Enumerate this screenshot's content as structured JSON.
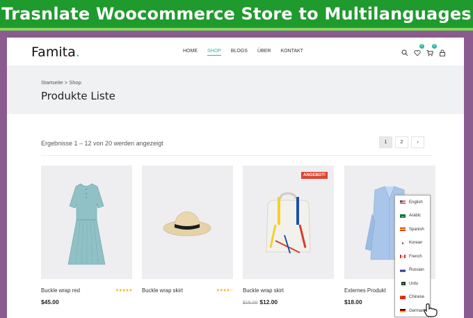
{
  "banner": {
    "title": "Trasnlate Woocommerce Store to Multilanguages"
  },
  "header": {
    "logo": "Famita",
    "logo_dot": ".",
    "nav": [
      {
        "label": "HOME",
        "active": false
      },
      {
        "label": "SHOP",
        "active": true
      },
      {
        "label": "BLOGS",
        "active": false
      },
      {
        "label": "ÜBER",
        "active": false
      },
      {
        "label": "KONTAKT",
        "active": false
      }
    ],
    "icons": [
      "search-icon",
      "heart-icon",
      "cart-icon",
      "lock-icon"
    ],
    "wishlist_count": "0",
    "cart_count": "0",
    "accent": "#2bb5a0"
  },
  "hero": {
    "breadcrumb": "Startseite >  Shop",
    "title": "Produkte Liste"
  },
  "results": "Ergebnisse 1 – 12 von 20 werden angezeigt",
  "pagination": {
    "pages": [
      "1",
      "2"
    ],
    "next": "›",
    "current": "1"
  },
  "products": [
    {
      "name": "Buckle wrap red",
      "price": "$45.00",
      "old_price": "",
      "badge": "",
      "rating": 4.5,
      "stars": "★★★★★",
      "image": "dress"
    },
    {
      "name": "Buckle wrap skirt",
      "price": "",
      "old_price": "",
      "badge": "",
      "rating": 4,
      "stars": "★★★★☆",
      "image": "hat"
    },
    {
      "name": "Buckle wrap skirt",
      "price": "$12.00",
      "old_price": "$15.00",
      "badge": "ANGEBOT!",
      "rating": 0,
      "stars": "",
      "image": "backpack"
    },
    {
      "name": "Externes Produkt",
      "price": "$18.00",
      "old_price": "",
      "badge": "",
      "rating": 0,
      "stars": "",
      "image": "shirt"
    }
  ],
  "languages": [
    {
      "label": "English",
      "flag": "us-flag-icon"
    },
    {
      "label": "Arabic",
      "flag": "sa-flag-icon"
    },
    {
      "label": "Spanish",
      "flag": "es-flag-icon"
    },
    {
      "label": "Korean",
      "flag": "kr-flag-icon"
    },
    {
      "label": "French",
      "flag": "ca-flag-icon"
    },
    {
      "label": "Russian",
      "flag": "ru-flag-icon"
    },
    {
      "label": "Urdu",
      "flag": "pk-flag-icon"
    },
    {
      "label": "Chinese",
      "flag": "cn-flag-icon"
    },
    {
      "label": "German",
      "flag": "de-flag-icon"
    }
  ],
  "colors": {
    "banner": "#1f9a2d",
    "frame_bg": "#8b5a8e",
    "sale": "#e0412f",
    "stars": "#f2b01e"
  }
}
